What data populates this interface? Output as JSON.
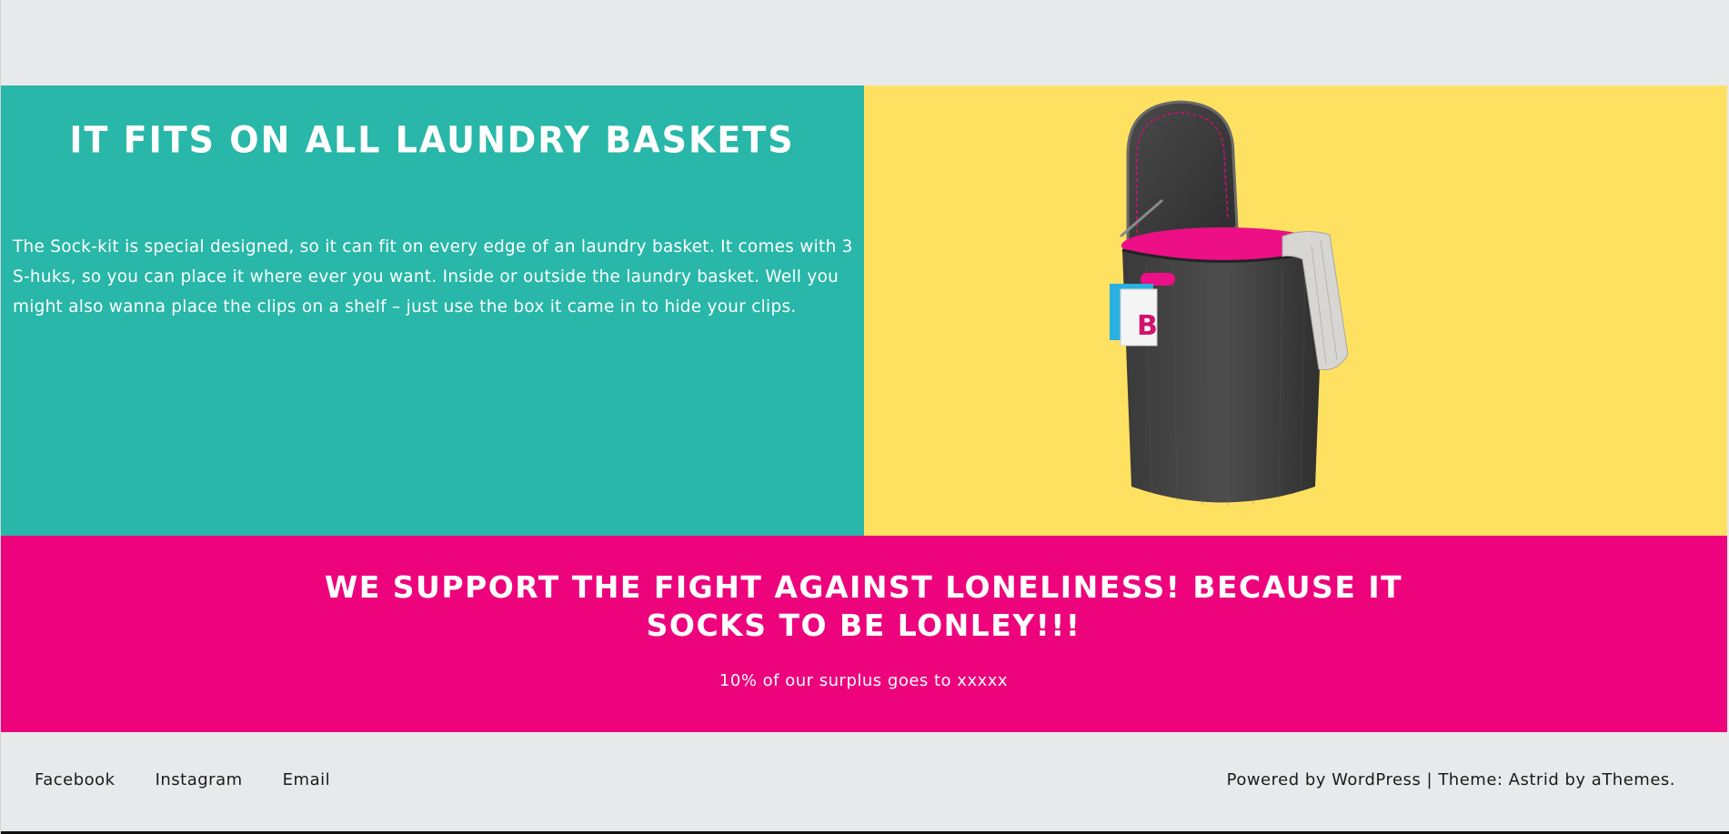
{
  "feature": {
    "title": "IT FITS ON ALL LAUNDRY BASKETS",
    "text": "The Sock-kit is special designed, so it can fit on every edge of an laundry basket. It comes with 3 S-huks, so you can place it where ever you want. Inside or outside the laundry basket. Well you might also wanna place the clips on a shelf – just use the box it came in to hide your clips.",
    "left_color": "#28b7a8",
    "right_color": "#ffe161"
  },
  "support": {
    "title": "WE SUPPORT THE FIGHT AGAINST LONELINESS! BECAUSE IT SOCKS TO BE LONLEY!!!",
    "subtitle": "10% of our surplus goes to xxxxx",
    "color": "#ed037c"
  },
  "footer": {
    "nav": [
      "Facebook",
      "Instagram",
      "Email"
    ],
    "credit_powered": "Powered by WordPress",
    "credit_separator": " | ",
    "credit_theme": "Theme: Astrid by aThemes."
  }
}
